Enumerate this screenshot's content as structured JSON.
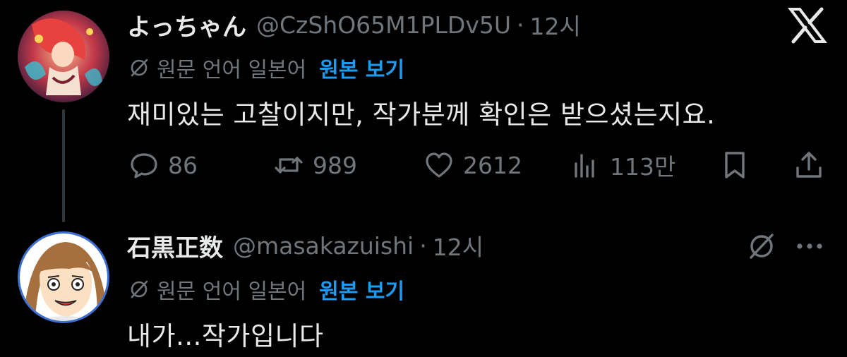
{
  "app": {
    "logo_icon": "x-logo-icon"
  },
  "tweets": [
    {
      "display_name": "よっちゃん",
      "handle": "@CzShO65M1PLDv5U",
      "separator": "·",
      "time": "12시",
      "translate_note": "원문 언어 일본어",
      "show_original": "원본 보기",
      "text": "재미있는 고찰이지만, 작가분께 확인은 받으셨는지요.",
      "stats": {
        "replies": "86",
        "retweets": "989",
        "likes": "2612",
        "views": "113만"
      }
    },
    {
      "display_name": "石黒正数",
      "handle": "@masakazuishi",
      "separator": "·",
      "time": "12시",
      "translate_note": "원문 언어 일본어",
      "show_original": "원본 보기",
      "text": "내가...작가입니다"
    }
  ],
  "colors": {
    "background": "#000000",
    "text_primary": "#e7e9ea",
    "text_secondary": "#71767b",
    "link": "#1d9bf0",
    "thread_line": "#333639"
  }
}
